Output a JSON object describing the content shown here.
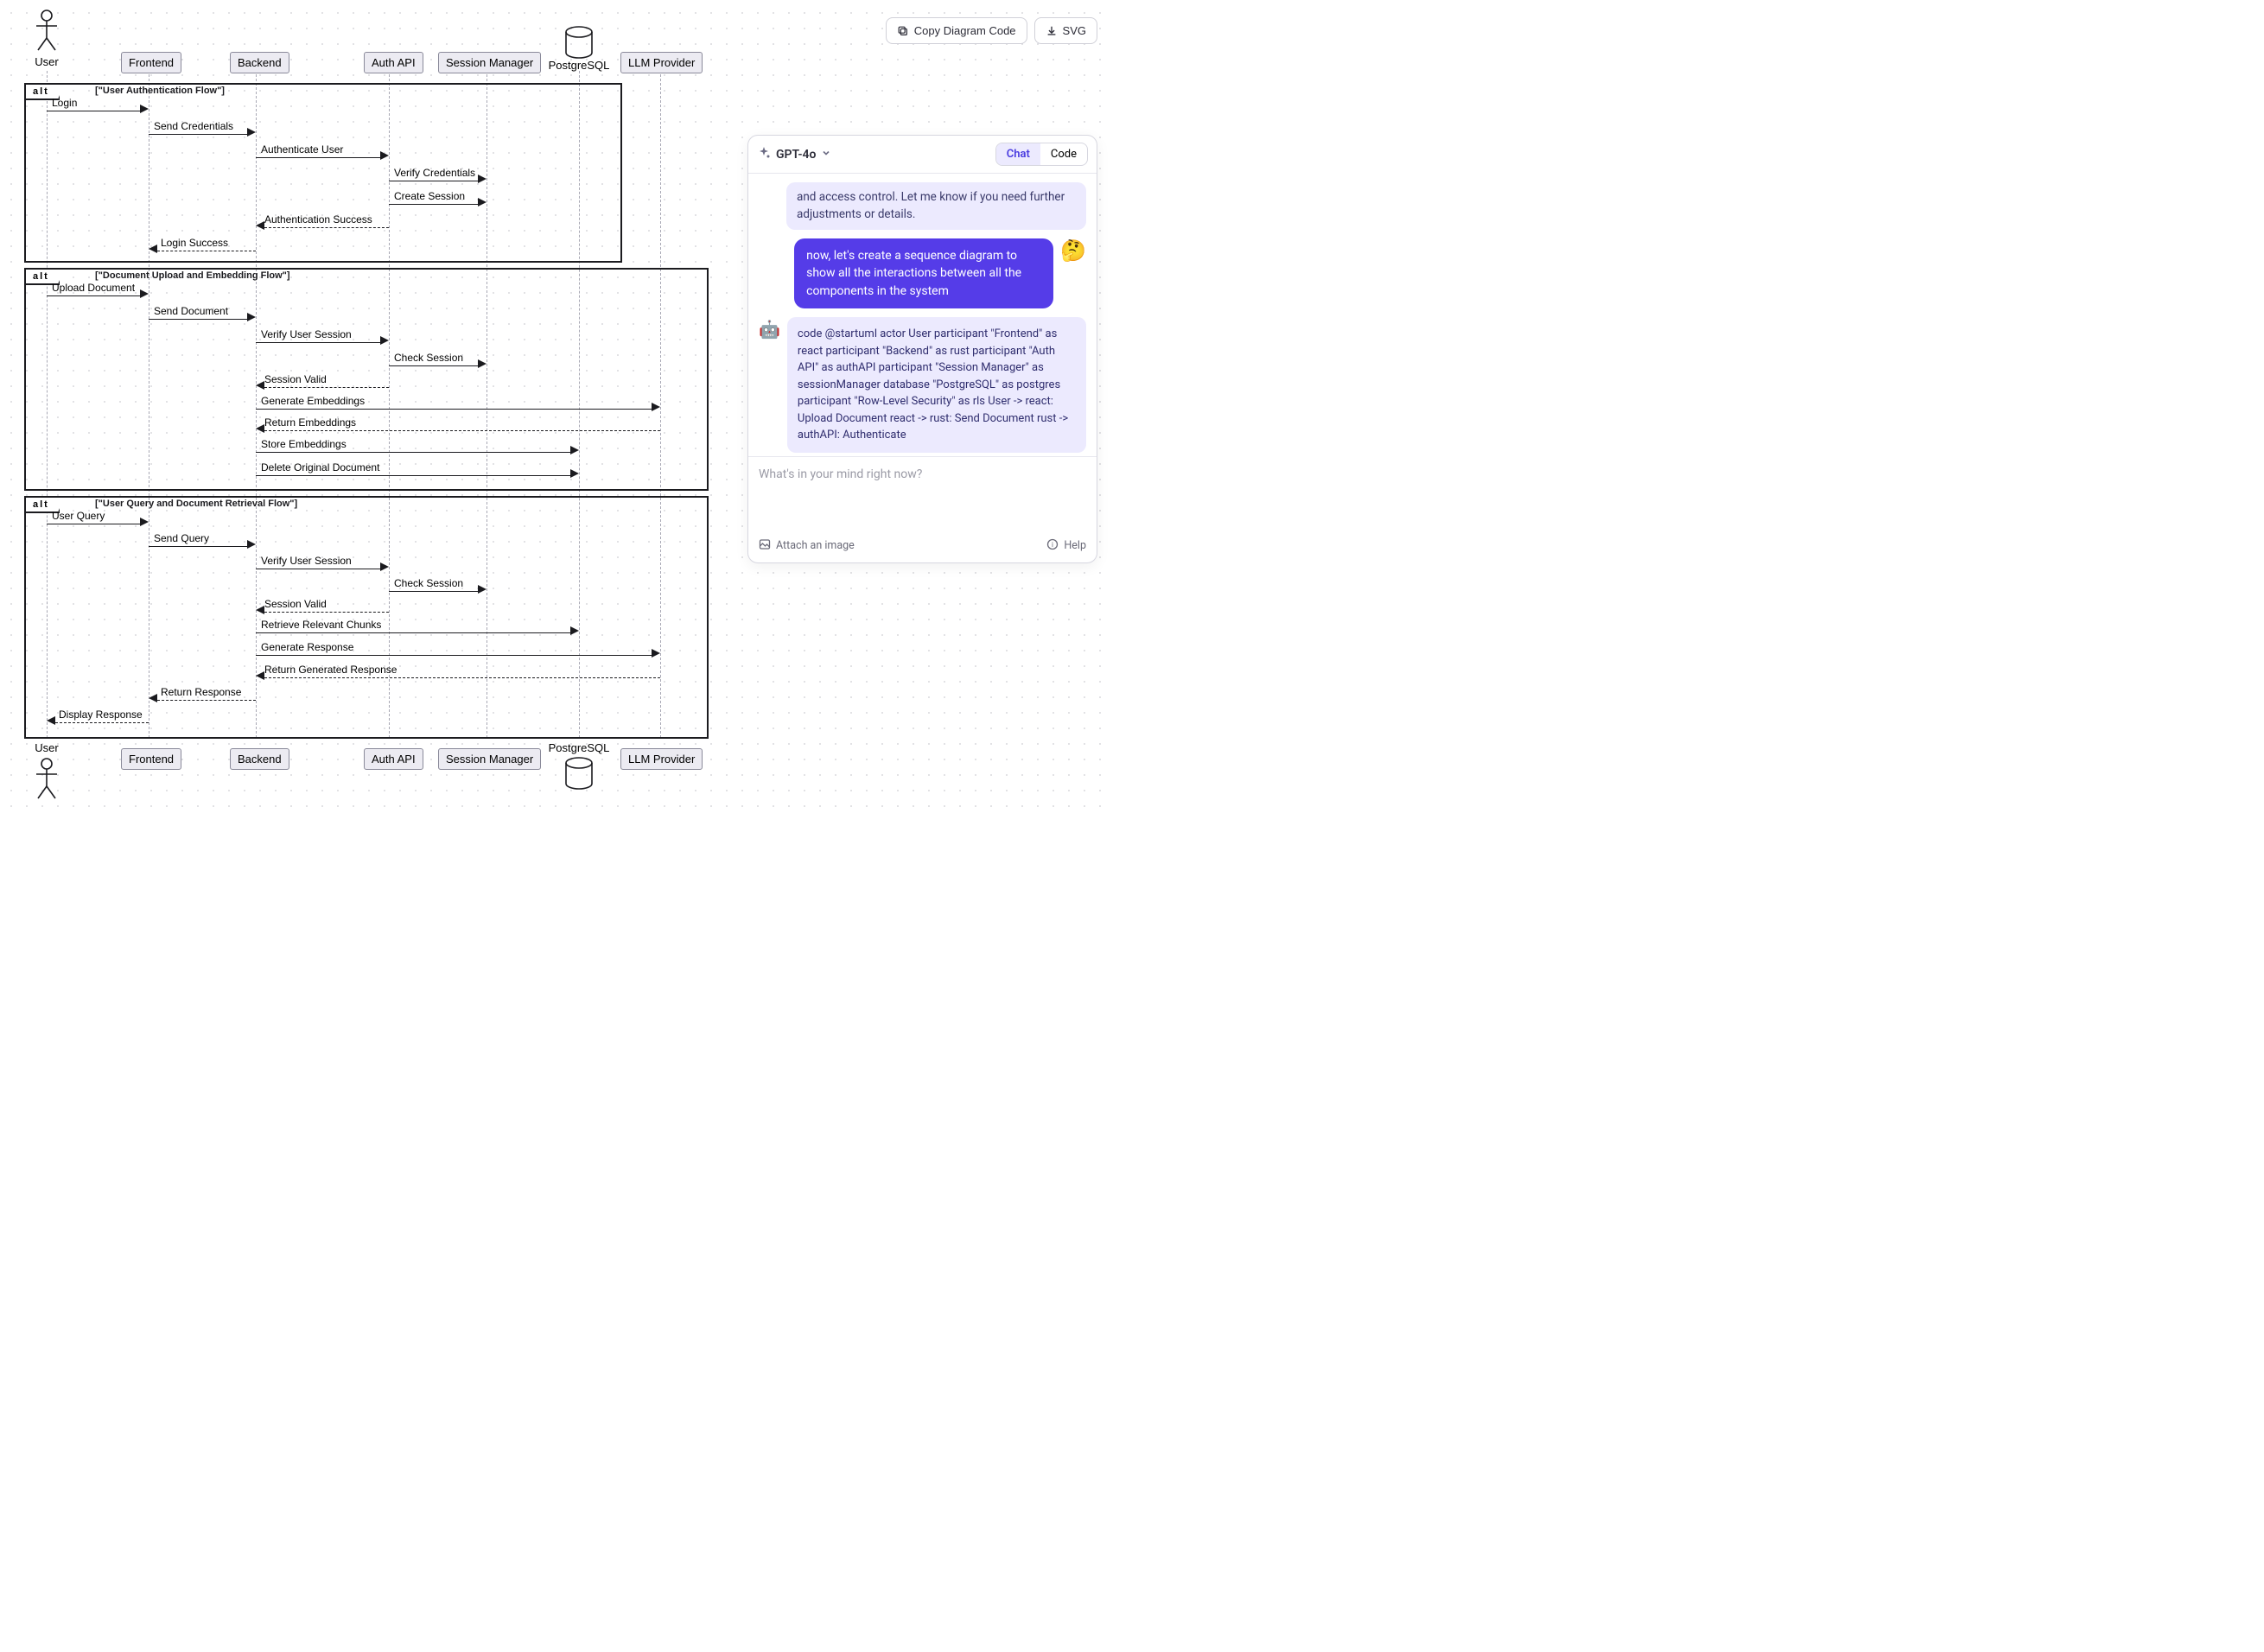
{
  "toolbar": {
    "copy_label": "Copy Diagram Code",
    "svg_label": "SVG"
  },
  "diagram": {
    "actor_top": "User",
    "actor_bottom": "User",
    "participants": [
      "Frontend",
      "Backend",
      "Auth API",
      "Session Manager",
      "LLM Provider"
    ],
    "db_label_top": "PostgreSQL",
    "db_label_bottom": "PostgreSQL",
    "fragments": [
      {
        "tag": "alt",
        "title": "[\"User Authentication Flow\"]",
        "messages": [
          {
            "from": "User",
            "to": "Frontend",
            "label": "Login",
            "style": "solid"
          },
          {
            "from": "Frontend",
            "to": "Backend",
            "label": "Send Credentials",
            "style": "solid"
          },
          {
            "from": "Backend",
            "to": "Auth API",
            "label": "Authenticate User",
            "style": "solid"
          },
          {
            "from": "Auth API",
            "to": "Session Manager",
            "label": "Verify Credentials",
            "style": "solid"
          },
          {
            "from": "Auth API",
            "to": "Session Manager",
            "label": "Create Session",
            "style": "solid"
          },
          {
            "from": "Auth API",
            "to": "Backend",
            "label": "Authentication Success",
            "style": "dashed"
          },
          {
            "from": "Backend",
            "to": "Frontend",
            "label": "Login Success",
            "style": "dashed"
          }
        ]
      },
      {
        "tag": "alt",
        "title": "[\"Document Upload and Embedding Flow\"]",
        "messages": [
          {
            "from": "User",
            "to": "Frontend",
            "label": "Upload Document",
            "style": "solid"
          },
          {
            "from": "Frontend",
            "to": "Backend",
            "label": "Send Document",
            "style": "solid"
          },
          {
            "from": "Backend",
            "to": "Auth API",
            "label": "Verify User Session",
            "style": "solid"
          },
          {
            "from": "Auth API",
            "to": "Session Manager",
            "label": "Check Session",
            "style": "solid"
          },
          {
            "from": "Auth API",
            "to": "Backend",
            "label": "Session Valid",
            "style": "dashed"
          },
          {
            "from": "Backend",
            "to": "LLM Provider",
            "label": "Generate Embeddings",
            "style": "solid"
          },
          {
            "from": "LLM Provider",
            "to": "Backend",
            "label": "Return Embeddings",
            "style": "dashed"
          },
          {
            "from": "Backend",
            "to": "PostgreSQL",
            "label": "Store Embeddings",
            "style": "solid"
          },
          {
            "from": "Backend",
            "to": "PostgreSQL",
            "label": "Delete Original Document",
            "style": "solid"
          }
        ]
      },
      {
        "tag": "alt",
        "title": "[\"User Query and Document Retrieval Flow\"]",
        "messages": [
          {
            "from": "User",
            "to": "Frontend",
            "label": "User Query",
            "style": "solid"
          },
          {
            "from": "Frontend",
            "to": "Backend",
            "label": "Send Query",
            "style": "solid"
          },
          {
            "from": "Backend",
            "to": "Auth API",
            "label": "Verify User Session",
            "style": "solid"
          },
          {
            "from": "Auth API",
            "to": "Session Manager",
            "label": "Check Session",
            "style": "solid"
          },
          {
            "from": "Auth API",
            "to": "Backend",
            "label": "Session Valid",
            "style": "dashed"
          },
          {
            "from": "Backend",
            "to": "PostgreSQL",
            "label": "Retrieve Relevant Chunks",
            "style": "solid"
          },
          {
            "from": "Backend",
            "to": "LLM Provider",
            "label": "Generate Response",
            "style": "solid"
          },
          {
            "from": "LLM Provider",
            "to": "Backend",
            "label": "Return Generated Response",
            "style": "dashed"
          },
          {
            "from": "Backend",
            "to": "Frontend",
            "label": "Return Response",
            "style": "dashed"
          },
          {
            "from": "Frontend",
            "to": "User",
            "label": "Display Response",
            "style": "dashed"
          }
        ]
      }
    ]
  },
  "chat": {
    "model": "GPT-4o",
    "tabs": {
      "chat": "Chat",
      "code": "Code"
    },
    "assistant_prev_tail": "and access control. Let me know if you need further adjustments or details.",
    "user_msg": "now, let's create a sequence diagram to show all the interactions between all the components in the system",
    "user_emoji": "🤔",
    "assistant_code": "code @startuml\nactor User\nparticipant \"Frontend\" as react participant \"Backend\" as rust participant \"Auth API\" as authAPI participant \"Session Manager\" as sessionManager database \"PostgreSQL\" as postgres participant \"Row-Level Security\" as rls\nUser -> react: Upload Document react -> rust: Send Document rust -> authAPI: Authenticate",
    "input_placeholder": "What's in your mind right now?",
    "attach_label": "Attach an image",
    "help_label": "Help"
  }
}
